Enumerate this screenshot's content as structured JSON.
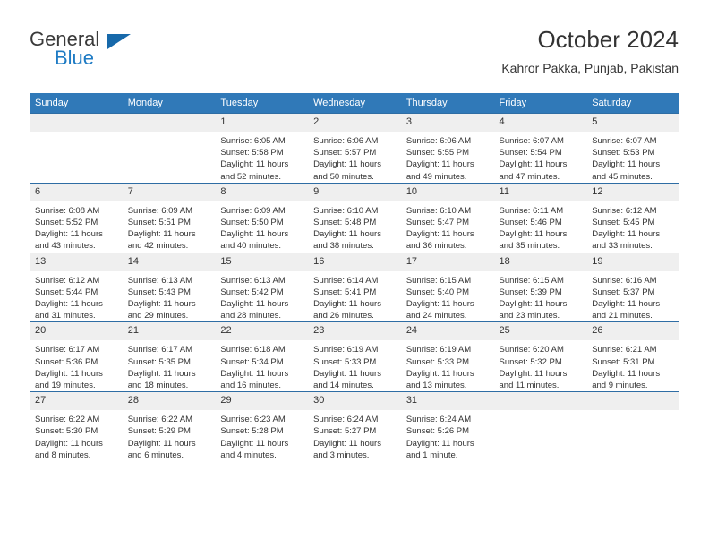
{
  "logo": {
    "top_text": "General",
    "bottom_text": "Blue",
    "triangle_color": "#1769aa",
    "blue_color": "#1e7bc4"
  },
  "header": {
    "title": "October 2024",
    "subtitle": "Kahror Pakka, Punjab, Pakistan"
  },
  "colors": {
    "header_blue": "#3079b8",
    "row_rule": "#2e6da4",
    "daynum_bg": "#efefef"
  },
  "calendar": {
    "weekday_headers": [
      "Sunday",
      "Monday",
      "Tuesday",
      "Wednesday",
      "Thursday",
      "Friday",
      "Saturday"
    ],
    "weeks": [
      [
        {
          "day": "",
          "sunrise": "",
          "sunset": "",
          "daylight": ""
        },
        {
          "day": "",
          "sunrise": "",
          "sunset": "",
          "daylight": ""
        },
        {
          "day": "1",
          "sunrise": "Sunrise: 6:05 AM",
          "sunset": "Sunset: 5:58 PM",
          "daylight": "Daylight: 11 hours and 52 minutes."
        },
        {
          "day": "2",
          "sunrise": "Sunrise: 6:06 AM",
          "sunset": "Sunset: 5:57 PM",
          "daylight": "Daylight: 11 hours and 50 minutes."
        },
        {
          "day": "3",
          "sunrise": "Sunrise: 6:06 AM",
          "sunset": "Sunset: 5:55 PM",
          "daylight": "Daylight: 11 hours and 49 minutes."
        },
        {
          "day": "4",
          "sunrise": "Sunrise: 6:07 AM",
          "sunset": "Sunset: 5:54 PM",
          "daylight": "Daylight: 11 hours and 47 minutes."
        },
        {
          "day": "5",
          "sunrise": "Sunrise: 6:07 AM",
          "sunset": "Sunset: 5:53 PM",
          "daylight": "Daylight: 11 hours and 45 minutes."
        }
      ],
      [
        {
          "day": "6",
          "sunrise": "Sunrise: 6:08 AM",
          "sunset": "Sunset: 5:52 PM",
          "daylight": "Daylight: 11 hours and 43 minutes."
        },
        {
          "day": "7",
          "sunrise": "Sunrise: 6:09 AM",
          "sunset": "Sunset: 5:51 PM",
          "daylight": "Daylight: 11 hours and 42 minutes."
        },
        {
          "day": "8",
          "sunrise": "Sunrise: 6:09 AM",
          "sunset": "Sunset: 5:50 PM",
          "daylight": "Daylight: 11 hours and 40 minutes."
        },
        {
          "day": "9",
          "sunrise": "Sunrise: 6:10 AM",
          "sunset": "Sunset: 5:48 PM",
          "daylight": "Daylight: 11 hours and 38 minutes."
        },
        {
          "day": "10",
          "sunrise": "Sunrise: 6:10 AM",
          "sunset": "Sunset: 5:47 PM",
          "daylight": "Daylight: 11 hours and 36 minutes."
        },
        {
          "day": "11",
          "sunrise": "Sunrise: 6:11 AM",
          "sunset": "Sunset: 5:46 PM",
          "daylight": "Daylight: 11 hours and 35 minutes."
        },
        {
          "day": "12",
          "sunrise": "Sunrise: 6:12 AM",
          "sunset": "Sunset: 5:45 PM",
          "daylight": "Daylight: 11 hours and 33 minutes."
        }
      ],
      [
        {
          "day": "13",
          "sunrise": "Sunrise: 6:12 AM",
          "sunset": "Sunset: 5:44 PM",
          "daylight": "Daylight: 11 hours and 31 minutes."
        },
        {
          "day": "14",
          "sunrise": "Sunrise: 6:13 AM",
          "sunset": "Sunset: 5:43 PM",
          "daylight": "Daylight: 11 hours and 29 minutes."
        },
        {
          "day": "15",
          "sunrise": "Sunrise: 6:13 AM",
          "sunset": "Sunset: 5:42 PM",
          "daylight": "Daylight: 11 hours and 28 minutes."
        },
        {
          "day": "16",
          "sunrise": "Sunrise: 6:14 AM",
          "sunset": "Sunset: 5:41 PM",
          "daylight": "Daylight: 11 hours and 26 minutes."
        },
        {
          "day": "17",
          "sunrise": "Sunrise: 6:15 AM",
          "sunset": "Sunset: 5:40 PM",
          "daylight": "Daylight: 11 hours and 24 minutes."
        },
        {
          "day": "18",
          "sunrise": "Sunrise: 6:15 AM",
          "sunset": "Sunset: 5:39 PM",
          "daylight": "Daylight: 11 hours and 23 minutes."
        },
        {
          "day": "19",
          "sunrise": "Sunrise: 6:16 AM",
          "sunset": "Sunset: 5:37 PM",
          "daylight": "Daylight: 11 hours and 21 minutes."
        }
      ],
      [
        {
          "day": "20",
          "sunrise": "Sunrise: 6:17 AM",
          "sunset": "Sunset: 5:36 PM",
          "daylight": "Daylight: 11 hours and 19 minutes."
        },
        {
          "day": "21",
          "sunrise": "Sunrise: 6:17 AM",
          "sunset": "Sunset: 5:35 PM",
          "daylight": "Daylight: 11 hours and 18 minutes."
        },
        {
          "day": "22",
          "sunrise": "Sunrise: 6:18 AM",
          "sunset": "Sunset: 5:34 PM",
          "daylight": "Daylight: 11 hours and 16 minutes."
        },
        {
          "day": "23",
          "sunrise": "Sunrise: 6:19 AM",
          "sunset": "Sunset: 5:33 PM",
          "daylight": "Daylight: 11 hours and 14 minutes."
        },
        {
          "day": "24",
          "sunrise": "Sunrise: 6:19 AM",
          "sunset": "Sunset: 5:33 PM",
          "daylight": "Daylight: 11 hours and 13 minutes."
        },
        {
          "day": "25",
          "sunrise": "Sunrise: 6:20 AM",
          "sunset": "Sunset: 5:32 PM",
          "daylight": "Daylight: 11 hours and 11 minutes."
        },
        {
          "day": "26",
          "sunrise": "Sunrise: 6:21 AM",
          "sunset": "Sunset: 5:31 PM",
          "daylight": "Daylight: 11 hours and 9 minutes."
        }
      ],
      [
        {
          "day": "27",
          "sunrise": "Sunrise: 6:22 AM",
          "sunset": "Sunset: 5:30 PM",
          "daylight": "Daylight: 11 hours and 8 minutes."
        },
        {
          "day": "28",
          "sunrise": "Sunrise: 6:22 AM",
          "sunset": "Sunset: 5:29 PM",
          "daylight": "Daylight: 11 hours and 6 minutes."
        },
        {
          "day": "29",
          "sunrise": "Sunrise: 6:23 AM",
          "sunset": "Sunset: 5:28 PM",
          "daylight": "Daylight: 11 hours and 4 minutes."
        },
        {
          "day": "30",
          "sunrise": "Sunrise: 6:24 AM",
          "sunset": "Sunset: 5:27 PM",
          "daylight": "Daylight: 11 hours and 3 minutes."
        },
        {
          "day": "31",
          "sunrise": "Sunrise: 6:24 AM",
          "sunset": "Sunset: 5:26 PM",
          "daylight": "Daylight: 11 hours and 1 minute."
        },
        {
          "day": "",
          "sunrise": "",
          "sunset": "",
          "daylight": ""
        },
        {
          "day": "",
          "sunrise": "",
          "sunset": "",
          "daylight": ""
        }
      ]
    ]
  }
}
